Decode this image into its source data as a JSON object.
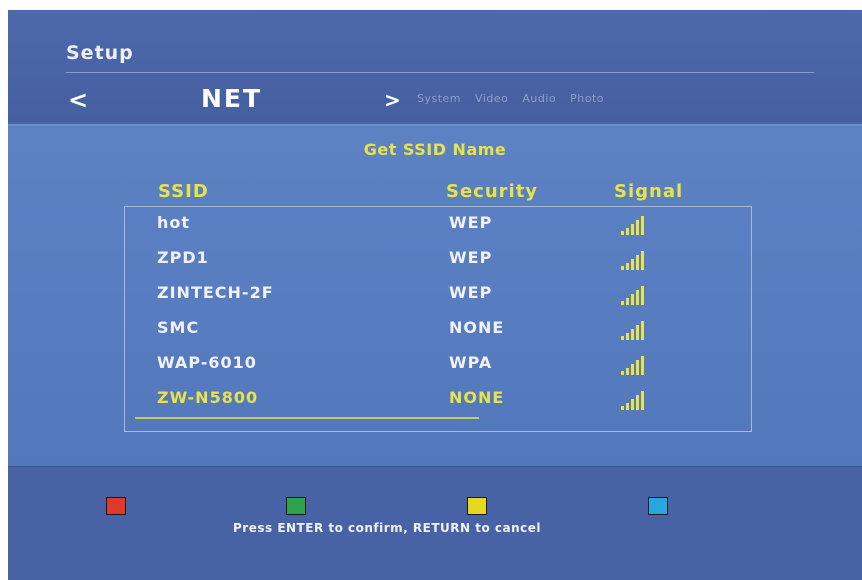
{
  "header": {
    "title": "Setup",
    "nav_left": "<",
    "nav_right": ">",
    "current_section": "NET",
    "menu_items": [
      "System",
      "Video",
      "Audio",
      "Photo"
    ]
  },
  "panel": {
    "title": "Get SSID Name",
    "columns": {
      "ssid": "SSID",
      "security": "Security",
      "signal": "Signal"
    },
    "networks": [
      {
        "ssid": "hot",
        "security": "WEP",
        "signal": "signal-icon"
      },
      {
        "ssid": "ZPD1",
        "security": "WEP",
        "signal": "signal-icon"
      },
      {
        "ssid": "ZINTECH-2F",
        "security": "WEP",
        "signal": "signal-icon"
      },
      {
        "ssid": "SMC",
        "security": "NONE",
        "signal": "signal-icon"
      },
      {
        "ssid": "WAP-6010",
        "security": "WPA",
        "signal": "signal-icon"
      },
      {
        "ssid": "ZW-N5800",
        "security": "NONE",
        "signal": "signal-icon",
        "selected": true
      }
    ]
  },
  "footer": {
    "buttons": [
      {
        "name": "red-button",
        "color": "#e0382b"
      },
      {
        "name": "green-button",
        "color": "#2da24a"
      },
      {
        "name": "yellow-button",
        "color": "#e6d820"
      },
      {
        "name": "blue-button",
        "color": "#2aa6df"
      }
    ],
    "hint": "Press ENTER to confirm, RETURN to cancel"
  },
  "colors": {
    "background": "#4a66a8",
    "panel": "#5c82c4",
    "highlight": "#e8e34a",
    "text": "#f0f2f8"
  }
}
